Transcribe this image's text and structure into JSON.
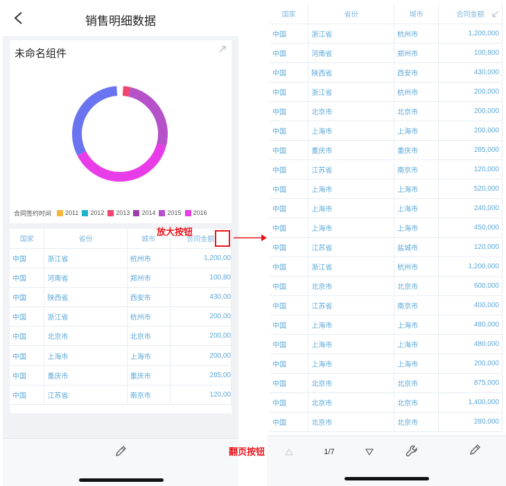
{
  "left": {
    "title": "销售明细数据",
    "widget": {
      "title": "未命名组件",
      "legend_title": "合同签约时间",
      "legend": [
        {
          "label": "2011",
          "color": "#f5b63c"
        },
        {
          "label": "2012",
          "color": "#1fb3c7"
        },
        {
          "label": "2013",
          "color": "#f0456e"
        },
        {
          "label": "2014",
          "color": "#9a3fa8"
        },
        {
          "label": "2015",
          "color": "#b84fd0"
        },
        {
          "label": "2016",
          "color": "#e83ce8"
        }
      ],
      "donut_colors": [
        "#f0456e",
        "#b552c9",
        "#e83ce8",
        "#6b74f0"
      ]
    },
    "table": {
      "headers": [
        "国家",
        "省份",
        "城市",
        "合同金额"
      ],
      "rows": [
        [
          "中国",
          "浙江省",
          "杭州市",
          "1,200,00"
        ],
        [
          "中国",
          "河南省",
          "郑州市",
          "100,80"
        ],
        [
          "中国",
          "陕西省",
          "西安市",
          "430,00"
        ],
        [
          "中国",
          "浙江省",
          "杭州市",
          "200,00"
        ],
        [
          "中国",
          "北京市",
          "北京市",
          "200,00"
        ],
        [
          "中国",
          "上海市",
          "上海市",
          "200,00"
        ],
        [
          "中国",
          "重庆市",
          "重庆市",
          "285,00"
        ],
        [
          "中国",
          "江苏省",
          "南京市",
          "120,00"
        ]
      ]
    }
  },
  "annotations": {
    "zoom_label": "放大按钮",
    "paging_label": "翻页按钮"
  },
  "right": {
    "table": {
      "headers": [
        "国家",
        "省份",
        "城市",
        "合同金额"
      ],
      "rows": [
        [
          "中国",
          "浙江省",
          "杭州市",
          "1,200,000"
        ],
        [
          "中国",
          "河南省",
          "郑州市",
          "100,800"
        ],
        [
          "中国",
          "陕西省",
          "西安市",
          "430,000"
        ],
        [
          "中国",
          "浙江省",
          "杭州市",
          "200,000"
        ],
        [
          "中国",
          "北京市",
          "北京市",
          "200,000"
        ],
        [
          "中国",
          "上海市",
          "上海市",
          "200,000"
        ],
        [
          "中国",
          "重庆市",
          "重庆市",
          "285,000"
        ],
        [
          "中国",
          "江苏省",
          "南京市",
          "120,000"
        ],
        [
          "中国",
          "上海市",
          "上海市",
          "520,000"
        ],
        [
          "中国",
          "上海市",
          "上海市",
          "240,000"
        ],
        [
          "中国",
          "上海市",
          "上海市",
          "450,000"
        ],
        [
          "中国",
          "江苏省",
          "盐城市",
          "120,000"
        ],
        [
          "中国",
          "浙江省",
          "杭州市",
          "1,200,000"
        ],
        [
          "中国",
          "北京市",
          "北京市",
          "600,000"
        ],
        [
          "中国",
          "江苏省",
          "南京市",
          "400,000"
        ],
        [
          "中国",
          "上海市",
          "上海市",
          "480,000"
        ],
        [
          "中国",
          "上海市",
          "上海市",
          "480,000"
        ],
        [
          "中国",
          "上海市",
          "上海市",
          "200,000"
        ],
        [
          "中国",
          "北京市",
          "北京市",
          "875,000"
        ],
        [
          "中国",
          "北京市",
          "北京市",
          "1,400,000"
        ],
        [
          "中国",
          "北京市",
          "北京市",
          "280,000"
        ]
      ]
    },
    "pager": {
      "text": "1/7"
    }
  },
  "colors": {
    "table_text": "#5aa7d8",
    "annotation_red": "#e8141d"
  }
}
